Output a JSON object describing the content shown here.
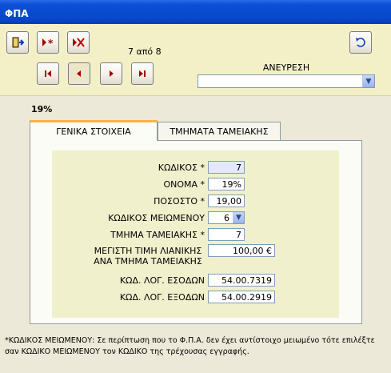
{
  "window": {
    "title": "ΦΠΑ"
  },
  "toolbar": {
    "record_position": "7 από 8",
    "search_label": "ΑΝΕΥΡΕΣΗ",
    "search_value": ""
  },
  "record_header": "19%",
  "tabs": [
    {
      "label": "ΓΕΝΙΚΑ ΣΤΟΙΧΕΙΑ",
      "active": true
    },
    {
      "label": "ΤΜΗΜΑΤΑ ΤΑΜΕΙΑΚΗΣ",
      "active": false
    }
  ],
  "form": {
    "code_label": "ΚΩΔΙΚΟΣ *",
    "code_value": "7",
    "name_label": "ΟΝΟΜΑ *",
    "name_value": "19%",
    "percent_label": "ΠΟΣΟΣΤΟ *",
    "percent_value": "19,00",
    "reduced_code_label": "ΚΩΔΙΚΟΣ ΜΕΙΩΜΕΝΟΥ",
    "reduced_code_value": "6",
    "cash_dept_label": "ΤΜΗΜΑ ΤΑΜΕΙΑΚΗΣ *",
    "cash_dept_value": "7",
    "max_price_label_1": "ΜΕΓΙΣΤΗ ΤΙΜΗ ΛΙΑΝΙΚΗΣ",
    "max_price_label_2": "ΑΝΑ ΤΜΗΜΑ ΤΑΜΕΙΑΚΗΣ",
    "max_price_value": "100,00 €",
    "income_account_label": "ΚΩΔ. ΛΟΓ. ΕΣΟΔΩΝ",
    "income_account_value": "54.00.7319",
    "expense_account_label": "ΚΩΔ. ΛΟΓ. ΕΞΟΔΩΝ",
    "expense_account_value": "54.00.2919"
  },
  "footnote_line1": "*ΚΩΔΙΚΟΣ ΜΕΙΩΜΕΝΟΥ:  Σε περίπτωση που το Φ.Π.Α. δεν έχει αντίστοιχο μειωμένο τότε επιλέξτε",
  "footnote_line2": "σαν ΚΩΔΙΚΟ ΜΕΙΩΜΕΝΟΥ τον ΚΩΔΙΚΟ της τρέχουσας εγγραφής."
}
